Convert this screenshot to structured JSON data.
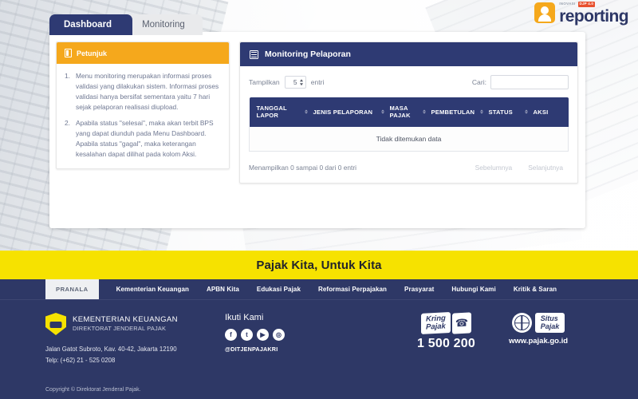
{
  "brand": {
    "tag_left": "INOVASI",
    "tag_right": "DJP 4.0",
    "name": "reporting",
    "mark": "e-logo-icon"
  },
  "tabs": [
    {
      "label": "Dashboard",
      "active": true
    },
    {
      "label": "Monitoring",
      "active": false
    }
  ],
  "petunjuk": {
    "title": "Petunjuk",
    "items": [
      "Menu monitoring merupakan informasi proses validasi yang dilakukan sistem. Informasi proses validasi hanya bersifat sementara yaitu 7 hari sejak pelaporan realisasi diupload.",
      "Apabila status \"selesai\", maka akan terbit BPS yang dapat diunduh pada Menu Dashboard. Apabila status \"gagal\", maka keterangan kesalahan dapat dilihat pada kolom Aksi."
    ]
  },
  "monitoring": {
    "title": "Monitoring Pelaporan",
    "show_label": "Tampilkan",
    "show_value": "5",
    "entries_label": "entri",
    "search_label": "Cari:",
    "search_value": "",
    "search_placeholder": "",
    "columns": [
      "TANGGAL LAPOR",
      "JENIS PELAPORAN",
      "MASA PAJAK",
      "PEMBETULAN",
      "STATUS",
      "AKSI"
    ],
    "empty_text": "Tidak ditemukan data",
    "rows": [],
    "info_text": "Menampilkan 0 sampai 0 dari 0 entri",
    "prev_label": "Sebelumnya",
    "next_label": "Selanjutnya"
  },
  "banner": {
    "slogan": "Pajak Kita, Untuk Kita",
    "background": "#f6e200"
  },
  "footer": {
    "nav_tab": "PRANALA",
    "links": [
      "Kementerian Keuangan",
      "APBN Kita",
      "Edukasi Pajak",
      "Reformasi Perpajakan",
      "Prasyarat",
      "Hubungi Kami",
      "Kritik & Saran"
    ],
    "org_line1": "KEMENTERIAN KEUANGAN",
    "org_line2": "DIREKTORAT JENDERAL PAJAK",
    "address": "Jalan Gatot Subroto, Kav. 40-42, Jakarta 12190",
    "phone": "Telp: (+62) 21 - 525 0208",
    "follow_title": "Ikuti Kami",
    "socials": [
      {
        "name": "facebook-icon",
        "glyph": "f"
      },
      {
        "name": "twitter-icon",
        "glyph": "t"
      },
      {
        "name": "youtube-icon",
        "glyph": "▶"
      },
      {
        "name": "instagram-icon",
        "glyph": "◎"
      }
    ],
    "handle": "@DITJENPAJAKRI",
    "kring_line1": "Kring",
    "kring_line2": "Pajak",
    "kring_number": "1 500 200",
    "situs_line1": "Situs",
    "situs_line2": "Pajak",
    "situs_url": "www.pajak.go.id",
    "copyright": "Copyright © Direktorat Jenderal Pajak.",
    "background": "#2e3866"
  },
  "colors": {
    "navy": "#2e3a73",
    "orange": "#f5a81c",
    "yellow": "#f6e200",
    "footer_navy": "#2e3866"
  }
}
